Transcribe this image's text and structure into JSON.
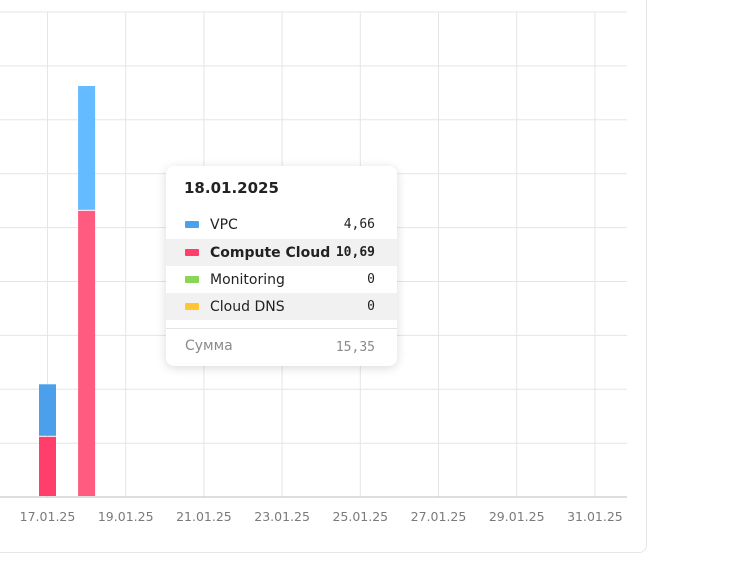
{
  "chart_data": {
    "type": "bar",
    "stacked": true,
    "x_ticks": [
      "17.01.25",
      "19.01.25",
      "21.01.25",
      "23.01.25",
      "25.01.25",
      "27.01.25",
      "29.01.25",
      "31.01.25"
    ],
    "dates": [
      "17.01.2025",
      "18.01.2025"
    ],
    "series": [
      {
        "name": "VPC",
        "color": "#4aa0ea",
        "values": [
          1.96,
          4.66
        ]
      },
      {
        "name": "Compute Cloud",
        "color": "#ff3e6b",
        "values": [
          2.25,
          10.69
        ]
      },
      {
        "name": "Monitoring",
        "color": "#8ad554",
        "values": [
          0,
          0
        ]
      },
      {
        "name": "Cloud DNS",
        "color": "#ffc534",
        "values": [
          0,
          0
        ]
      }
    ],
    "grid": true,
    "legend": "none"
  },
  "tooltip": {
    "date": "18.01.2025",
    "rows": [
      {
        "name": "VPC",
        "value": "4,66",
        "color": "#4aa0ea"
      },
      {
        "name": "Compute Cloud",
        "value": "10,69",
        "color": "#ff3e6b"
      },
      {
        "name": "Monitoring",
        "value": "0",
        "color": "#8ad554"
      },
      {
        "name": "Cloud DNS",
        "value": "0",
        "color": "#ffc534"
      }
    ],
    "sum_label": "Сумма",
    "sum_value": "15,35"
  }
}
